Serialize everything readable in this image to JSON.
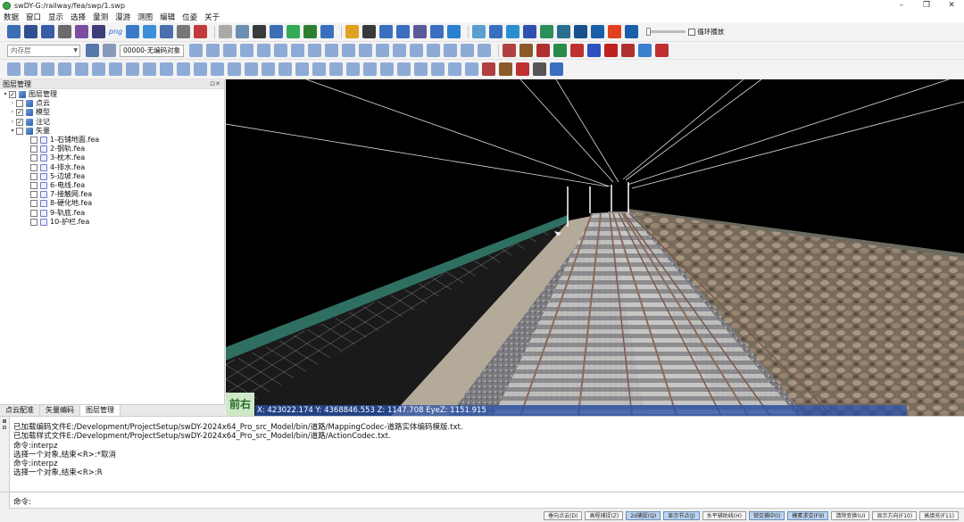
{
  "window": {
    "title": "swDY-G:/railway/fea/swp/1.swp",
    "minimize": "–",
    "restore": "❐",
    "close": "✕"
  },
  "menu": [
    "数据",
    "窗口",
    "显示",
    "选择",
    "量测",
    "漫游",
    "测图",
    "编辑",
    "位姿",
    "关于"
  ],
  "toolbar1": {
    "icons": [
      "#3b6fb5",
      "#2f4f8f",
      "#3a5ca6",
      "#6b6b6b",
      "#7a4fa0",
      "#3d3d7a",
      "#3a7ac8",
      "#3b8fd9",
      "#4a6fb0",
      "#777",
      "#c43a3a",
      "#aaa",
      "#6a8fb0",
      "#3a3a3a",
      "#3a6fb5",
      "#33aa55",
      "#2d7f30",
      "#3a6fc0",
      "#e0a020",
      "#3a3a3a",
      "#3a6fc0",
      "#3a6fc0",
      "#5a5a9a",
      "#3a6fc0",
      "#2a7fd0",
      "#5a9fd0",
      "#3a6fc0",
      "#2a8fd0",
      "#3050b0",
      "#2a8f5a",
      "#2a6f8f",
      "#1a4f8f",
      "#1a5fa8",
      "#e04020",
      "#1a5fa8"
    ],
    "png_label": "png",
    "loop_label": "循环播放"
  },
  "toolbar2": {
    "layer_combo": "内存层",
    "code_field": "00000-无编码对象",
    "icons": [
      "#3a6fc0",
      "#3a6fc0",
      "#3a6fc0",
      "#3a6fc0",
      "#3a6fc0",
      "#3a6fc0",
      "#3a6fc0",
      "#3a6fc0",
      "#3a6fc0",
      "#3a6fc0",
      "#3a6fc0",
      "#3a6fc0",
      "#3a6fc0",
      "#3a6fc0",
      "#3a6fc0",
      "#3a6fc0",
      "#3a6fc0",
      "#3a6fc0",
      "#b04040",
      "#8a5a2a",
      "#b03030",
      "#2a8a4a",
      "#c03030",
      "#3050c0",
      "#c02020",
      "#b03030",
      "#3a7fd0",
      "#c03030"
    ]
  },
  "toolbar3": {
    "icons": [
      "#3a6fc0",
      "#3a6fc0",
      "#3a6fc0",
      "#3a6fc0",
      "#3a6fc0",
      "#3a6fc0",
      "#3a6fc0",
      "#3a6fc0",
      "#3a6fc0",
      "#3a6fc0",
      "#3a6fc0",
      "#3a6fc0",
      "#3a6fc0",
      "#3a6fc0",
      "#3a6fc0",
      "#3a6fc0",
      "#3a6fc0",
      "#3a6fc0",
      "#3a6fc0",
      "#3a6fc0",
      "#3a6fc0",
      "#3a6fc0",
      "#3a6fc0",
      "#3a6fc0",
      "#3a6fc0",
      "#3a6fc0",
      "#3a6fc0",
      "#3a6fc0",
      "#b04040",
      "#8a5a2a",
      "#c03030",
      "#555",
      "#3a6fc0"
    ]
  },
  "layer_panel": {
    "title": "图层管理",
    "root": "图层管理",
    "groups": [
      {
        "label": "点云",
        "checked": false
      },
      {
        "label": "模型",
        "checked": true
      },
      {
        "label": "注记",
        "checked": true
      },
      {
        "label": "矢量",
        "checked": false
      }
    ],
    "files": [
      "1-石铺地面.fea",
      "2-钢轨.fea",
      "3-枕木.fea",
      "4-排水.fea",
      "5-边坡.fea",
      "6-电线.fea",
      "7-接触网.fea",
      "8-硬化地.fea",
      "9-轨底.fea",
      "10-护栏.fea"
    ],
    "tabs": [
      "点云配准",
      "矢量编码",
      "图层管理"
    ]
  },
  "viewport": {
    "coords": "X: 423022.174 Y: 4368846.553 Z: 1147.708 EyeZ: 1151.915",
    "nav": "前右"
  },
  "console": {
    "lines": [
      "已加载编码文件E:/Development/ProjectSetup/swDY-2024x64_Pro_src_Model/bin/道路/MappingCodec-道路实体编码模版.txt.",
      "已加载样式文件E:/Development/ProjectSetup/swDY-2024x64_Pro_src_Model/bin/道路/ActionCodec.txt.",
      "命令:interpz",
      "选择一个对象,结束<R>:*取消",
      "命令:interpz",
      "选择一个对象,结束<R>:R"
    ],
    "side_label": "口令编辑",
    "prompt": "命令:"
  },
  "status_buttons": [
    {
      "label": "垂向点云(D)",
      "on": false
    },
    {
      "label": "高程捕捉(Z)",
      "on": false
    },
    {
      "label": "2d捕捉(Q)",
      "on": true
    },
    {
      "label": "显示节点(J)",
      "on": true
    },
    {
      "label": "水平辅助线(H)",
      "on": false
    },
    {
      "label": "锁交捕中(I)",
      "on": true
    },
    {
      "label": "模素求交(F9)",
      "on": true
    },
    {
      "label": "清除变换(U)",
      "on": false
    },
    {
      "label": "显示方向(F10)",
      "on": false
    },
    {
      "label": "高填充(F11)",
      "on": false
    }
  ]
}
